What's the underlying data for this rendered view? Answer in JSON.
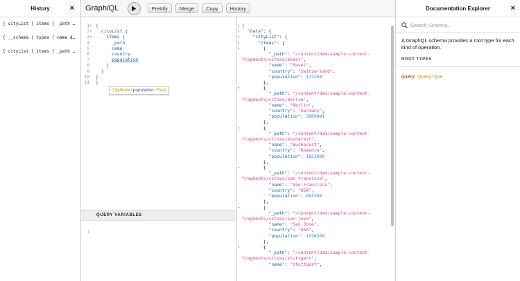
{
  "history": {
    "title": "History",
    "items": [
      "{ cityList { items { _path n...",
      "{ __schema { types { name de...",
      "{ cityList { items { _path n..."
    ]
  },
  "toolbar": {
    "title_prefix": "Graph",
    "title_italic": "i",
    "title_suffix": "QL",
    "prettify": "Prettify",
    "merge": "Merge",
    "copy": "Copy",
    "history": "History"
  },
  "query_editor": {
    "line_numbers": [
      "1",
      "2",
      "3",
      "4",
      "5",
      "6",
      "7",
      "8",
      "9",
      "10",
      "11"
    ],
    "lines": [
      {
        "indent": "",
        "text": "{",
        "cls": "punc"
      },
      {
        "indent": "  ",
        "text": "cityList {",
        "cls": "def"
      },
      {
        "indent": "    ",
        "text": "items {",
        "cls": "def"
      },
      {
        "indent": "      ",
        "text": "_path",
        "cls": "field"
      },
      {
        "indent": "      ",
        "text": "name",
        "cls": "field"
      },
      {
        "indent": "      ",
        "text": "country",
        "cls": "field"
      },
      {
        "indent": "      ",
        "text": "population",
        "cls": "field under"
      },
      {
        "indent": "    ",
        "text": "}",
        "cls": "punc"
      },
      {
        "indent": "  ",
        "text": "}",
        "cls": "punc"
      },
      {
        "indent": "",
        "text": "}",
        "cls": "punc"
      },
      {
        "indent": "",
        "text": "",
        "cls": "punc"
      }
    ],
    "tooltip": {
      "type": "CityModel",
      "field": "population",
      "scalar": "Float"
    }
  },
  "query_variables": {
    "header": "QUERY VARIABLES",
    "line_numbers": [
      "1"
    ]
  },
  "result": {
    "cities": [
      {
        "path_a": "/content/dam/sample-content-",
        "path_b": "fragments/cities/basel",
        "name": "Basel",
        "country": "Switzerland",
        "population": "172258"
      },
      {
        "path_a": "/content/dam/sample-content-",
        "path_b": "fragments/cities/berlin",
        "name": "Berlin",
        "country": "Germany",
        "population": "3669491"
      },
      {
        "path_a": "/content/dam/sample-content-",
        "path_b": "fragments/cities/bucharest",
        "name": "Bucharest",
        "country": "Romania",
        "population": "1821000"
      },
      {
        "path_a": "/content/dam/sample-content-",
        "path_b": "fragments/cities/san-francisco",
        "name": "San Francisco",
        "country": "USA",
        "population": "883306"
      },
      {
        "path_a": "/content/dam/sample-content-",
        "path_b": "fragments/cities/san-jose",
        "name": "San Jose",
        "country": "USA",
        "population": "1026350"
      },
      {
        "path_a": "/content/dam/sample-content-",
        "path_b": "fragments/cities/stuttgart",
        "name": "Stuttgart",
        "country": "",
        "population": ""
      }
    ]
  },
  "docs": {
    "title": "Documentation Explorer",
    "search_placeholder": "Search Schema...",
    "description": "A GraphQL schema provides a root type for each kind of operation.",
    "root_types_label": "ROOT TYPES",
    "query_label": "query",
    "query_type": "QueryType"
  },
  "colors": {
    "string": "#d64292",
    "number": "#2882f9",
    "key": "#1f61a0",
    "type": "#ca9800",
    "keyword": "#b11a04"
  }
}
